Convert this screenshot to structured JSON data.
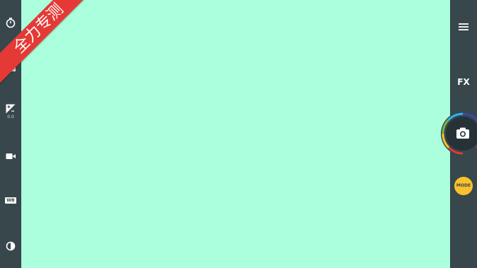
{
  "left_toolbar": {
    "items": [
      {
        "name": "timer",
        "icon": "timer-icon"
      },
      {
        "name": "gallery",
        "icon": "image-icon"
      },
      {
        "name": "exposure",
        "icon": "exposure-icon",
        "value": "0.0"
      },
      {
        "name": "video",
        "icon": "video-camera-icon"
      },
      {
        "name": "white-balance",
        "icon": "wb-icon",
        "label": "WB"
      },
      {
        "name": "contrast",
        "icon": "contrast-icon"
      }
    ]
  },
  "right_toolbar": {
    "menu_icon": "menu-icon",
    "fx_label": "FX",
    "shutter_icon": "camera-icon",
    "mode_label": "MODE"
  },
  "ribbon": {
    "text": "全力专测"
  },
  "colors": {
    "toolbar": "#37474b",
    "viewfinder": "#abffdc",
    "mode_button": "#fbc02d",
    "ribbon": "#e53935"
  }
}
